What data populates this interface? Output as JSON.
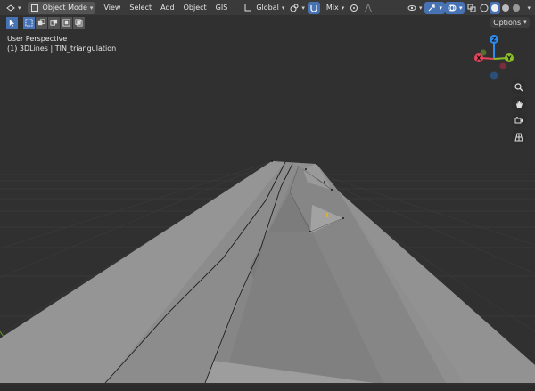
{
  "header": {
    "mode_label": "Object Mode",
    "menu": [
      "View",
      "Select",
      "Add",
      "Object",
      "GIS"
    ],
    "transform_orientation": "Global",
    "snap_mode": "Mix",
    "options_label": "Options"
  },
  "viewport": {
    "perspective_label": "User Perspective",
    "object_label": "(1) 3DLines | TIN_triangulation"
  },
  "gizmo": {
    "x_label": "X",
    "y_label": "Y",
    "z_label": "Z",
    "x_color": "#e8445a",
    "y_color": "#8bbf29",
    "z_color": "#2d8ced"
  },
  "icons": [
    "cursor-icon",
    "select-box-icon",
    "snap-icon",
    "proportional-edit-icon",
    "zoom-icon",
    "hand-icon",
    "camera-icon",
    "grid-icon"
  ]
}
